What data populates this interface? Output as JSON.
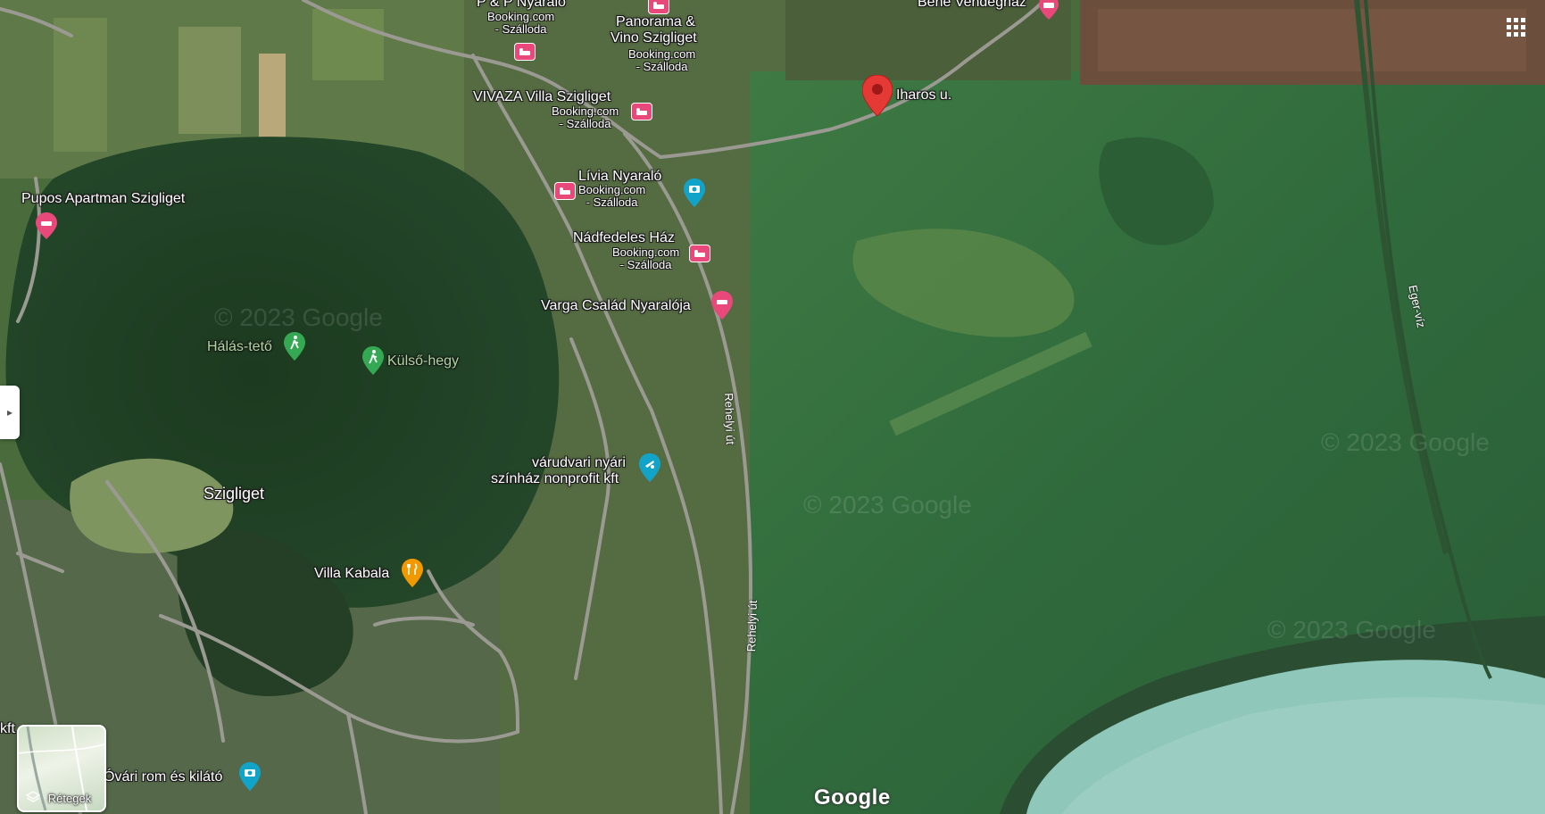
{
  "map": {
    "labels": {
      "pp_nyaralo": "P & P Nyaraló",
      "panorama": "Panorama &",
      "panorama2": "Vino Szigliget",
      "bene": "Bene Vendégház",
      "iharos": "Iharos u.",
      "vivaza": "VIVAZA Villa Szigliget",
      "livia": "Lívia Nyaraló",
      "pupos": "Pupos Apartman Szigliget",
      "nadfedeles": "Nádfedeles Ház",
      "varga": "Varga Család Nyaralója",
      "halas": "Hálás-tető",
      "kulso": "Külső-hegy",
      "varudvari1": "várudvari nyári",
      "varudvari2": "színház nonprofit kft",
      "szigliget": "Szigliget",
      "kabala": "Villa Kabala",
      "ovari": "Óvári rom és kilátó",
      "kft": "kft",
      "booking": "Booking.com",
      "szalloda": "- Szálloda"
    },
    "roads": {
      "rehelyi": "Rehelyi út",
      "eger": "Eger-víz"
    },
    "watermark": "© 2023 Google",
    "logo": "Google",
    "layers_label": "Rétegek"
  },
  "colors": {
    "hotel_pin": "#e8487a",
    "selected_pin": "#e53935",
    "camera_pin": "#12a4c8",
    "hike_pin": "#34a853",
    "food_pin": "#f29900",
    "water": "#8fc7bb"
  },
  "icons": {
    "hotel": "bed-icon",
    "camera": "camera-icon",
    "hike": "hiking-icon",
    "food": "restaurant-icon",
    "apps": "apps-grid-icon",
    "layers": "layers-icon",
    "toggle": "chevron-right-icon"
  }
}
